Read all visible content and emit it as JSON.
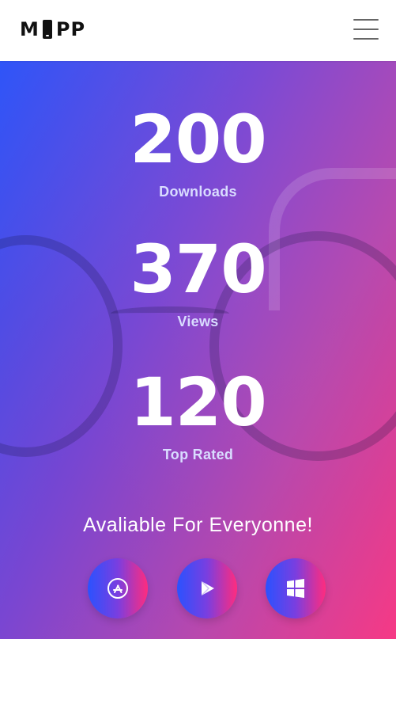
{
  "header": {
    "logo_left": "M",
    "logo_right": "PP"
  },
  "hero": {
    "stats": [
      {
        "value": "200",
        "label": "Downloads"
      },
      {
        "value": "370",
        "label": "Views"
      },
      {
        "value": "120",
        "label": "Top Rated"
      }
    ],
    "availability_title": "Avaliable For Everyonne!",
    "stores": [
      {
        "icon": "app-store-icon"
      },
      {
        "icon": "google-play-icon"
      },
      {
        "icon": "windows-store-icon"
      }
    ]
  },
  "colors": {
    "gradient_start": "#2a52ff",
    "gradient_mid": "#7a3ee0",
    "gradient_end": "#ff2c7e",
    "stat_label": "#d9dcff",
    "logo_text": "#111111",
    "hamburger": "#666666"
  }
}
